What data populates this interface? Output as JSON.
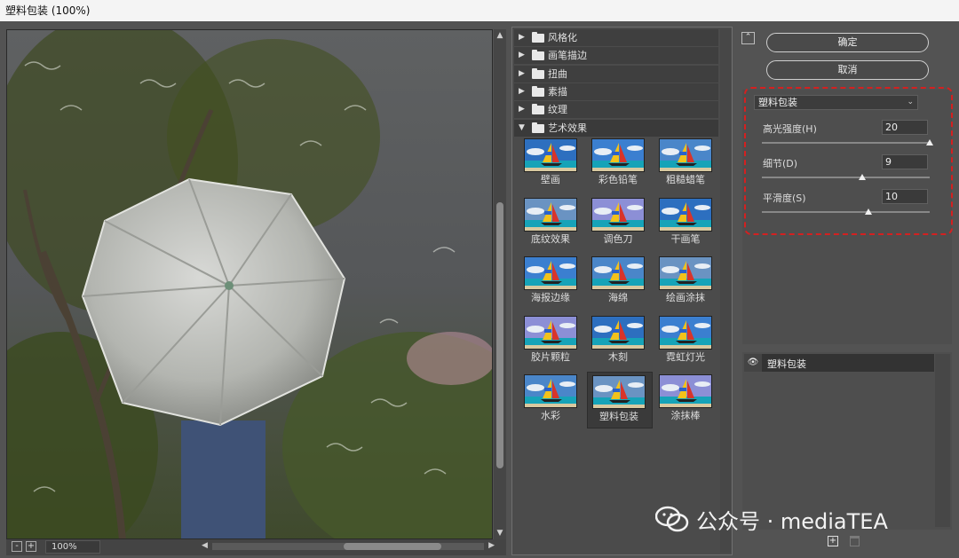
{
  "window": {
    "title": "塑料包装 (100%)"
  },
  "preview": {
    "zoom": "100%",
    "zoom_out": "-",
    "zoom_in": "+"
  },
  "gallery": {
    "categories": [
      {
        "label": "风格化",
        "open": false
      },
      {
        "label": "画笔描边",
        "open": false
      },
      {
        "label": "扭曲",
        "open": false
      },
      {
        "label": "素描",
        "open": false
      },
      {
        "label": "纹理",
        "open": false
      },
      {
        "label": "艺术效果",
        "open": true
      }
    ],
    "effects": [
      {
        "label": "壁画"
      },
      {
        "label": "彩色铅笔"
      },
      {
        "label": "粗糙蜡笔"
      },
      {
        "label": "底纹效果"
      },
      {
        "label": "调色刀"
      },
      {
        "label": "干画笔"
      },
      {
        "label": "海报边缘"
      },
      {
        "label": "海绵"
      },
      {
        "label": "绘画涂抹"
      },
      {
        "label": "胶片颗粒"
      },
      {
        "label": "木刻"
      },
      {
        "label": "霓虹灯光"
      },
      {
        "label": "水彩"
      },
      {
        "label": "塑料包装",
        "selected": true
      },
      {
        "label": "涂抹棒"
      }
    ]
  },
  "actions": {
    "ok": "确定",
    "cancel": "取消",
    "collapse": "⌃"
  },
  "settings": {
    "filter": "塑料包装",
    "params": [
      {
        "label": "高光强度(H)",
        "value": "20",
        "fraction": 1.0
      },
      {
        "label": "细节(D)",
        "value": "9",
        "fraction": 0.6
      },
      {
        "label": "平滑度(S)",
        "value": "10",
        "fraction": 0.635
      }
    ]
  },
  "layers": {
    "items": [
      {
        "label": "塑料包装"
      }
    ]
  },
  "watermark": {
    "text": "公众号 · mediaTEA"
  },
  "colors": {
    "highlight": "#d42020",
    "panel": "#535353"
  }
}
